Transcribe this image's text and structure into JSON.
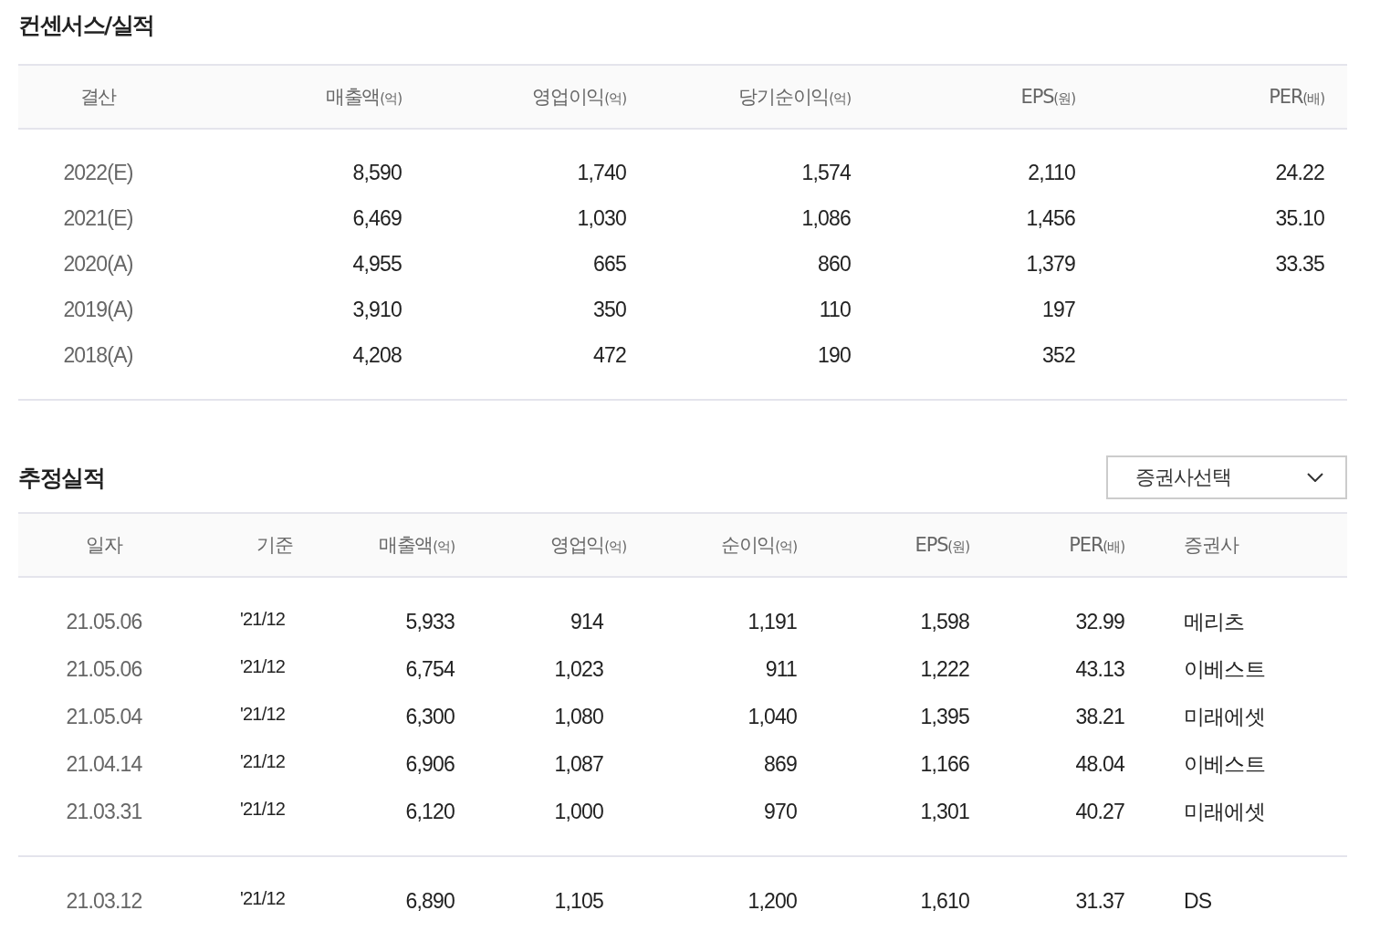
{
  "consensus": {
    "title": "컨센서스/실적",
    "columns": [
      {
        "label": "결산"
      },
      {
        "label": "매출액",
        "unit": "(억)"
      },
      {
        "label": "영업이익",
        "unit": "(억)"
      },
      {
        "label": "당기순이익",
        "unit": "(억)"
      },
      {
        "label": "EPS",
        "unit": "(원)"
      },
      {
        "label": "PER",
        "unit": "(배)"
      }
    ],
    "rows": [
      [
        "2022(E)",
        "8,590",
        "1,740",
        "1,574",
        "2,110",
        "24.22"
      ],
      [
        "2021(E)",
        "6,469",
        "1,030",
        "1,086",
        "1,456",
        "35.10"
      ],
      [
        "2020(A)",
        "4,955",
        "665",
        "860",
        "1,379",
        "33.35"
      ],
      [
        "2019(A)",
        "3,910",
        "350",
        "110",
        "197",
        ""
      ],
      [
        "2018(A)",
        "4,208",
        "472",
        "190",
        "352",
        ""
      ]
    ]
  },
  "estimates": {
    "title": "추정실적",
    "broker_select": {
      "value": "증권사선택"
    },
    "columns": [
      {
        "label": "일자"
      },
      {
        "label": "기준"
      },
      {
        "label": "매출액",
        "unit": "(억)"
      },
      {
        "label": "영업익",
        "unit": "(억)"
      },
      {
        "label": "순이익",
        "unit": "(억)"
      },
      {
        "label": "EPS",
        "unit": "(원)"
      },
      {
        "label": "PER",
        "unit": "(배)"
      },
      {
        "label": "증권사"
      }
    ],
    "row_groups": [
      {
        "rows": [
          [
            "21.05.06",
            "'21/12",
            "5,933",
            "914",
            "1,191",
            "1,598",
            "32.99",
            "메리츠"
          ],
          [
            "21.05.06",
            "'21/12",
            "6,754",
            "1,023",
            "911",
            "1,222",
            "43.13",
            "이베스트"
          ],
          [
            "21.05.04",
            "'21/12",
            "6,300",
            "1,080",
            "1,040",
            "1,395",
            "38.21",
            "미래에셋"
          ],
          [
            "21.04.14",
            "'21/12",
            "6,906",
            "1,087",
            "869",
            "1,166",
            "48.04",
            "이베스트"
          ],
          [
            "21.03.31",
            "'21/12",
            "6,120",
            "1,000",
            "970",
            "1,301",
            "40.27",
            "미래에셋"
          ]
        ]
      },
      {
        "rows": [
          [
            "21.03.12",
            "'21/12",
            "6,890",
            "1,105",
            "1,200",
            "1,610",
            "31.37",
            "DS"
          ]
        ]
      }
    ]
  }
}
